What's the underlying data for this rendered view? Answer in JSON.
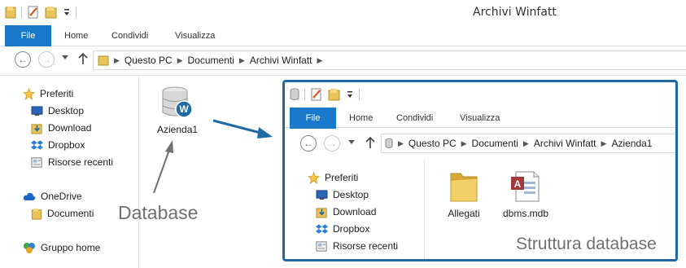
{
  "window": {
    "title": "Archivi Winfatt",
    "ribbon_tabs": {
      "file": "File",
      "home": "Home",
      "share": "Condividi",
      "view": "Visualizza"
    },
    "address": [
      "Questo PC",
      "Documenti",
      "Archivi Winfatt"
    ]
  },
  "nav": {
    "favorites": "Preferiti",
    "desktop": "Desktop",
    "download": "Download",
    "dropbox": "Dropbox",
    "recent": "Risorse recenti",
    "onedrive": "OneDrive",
    "documents": "Documenti",
    "homegroup": "Gruppo home"
  },
  "files": [
    {
      "name": "Azienda1",
      "icon": "database-icon"
    }
  ],
  "annotations": {
    "database": "Database",
    "structure": "Struttura database"
  },
  "inner_window": {
    "ribbon_tabs": {
      "file": "File",
      "home": "Home",
      "share": "Condividi",
      "view": "Visualizza"
    },
    "address": [
      "Questo PC",
      "Documenti",
      "Archivi Winfatt",
      "Azienda1"
    ],
    "nav": {
      "favorites": "Preferiti",
      "desktop": "Desktop",
      "download": "Download",
      "dropbox": "Dropbox",
      "recent": "Risorse recenti"
    },
    "files": [
      {
        "name": "Allegati",
        "icon": "folder-icon"
      },
      {
        "name": "dbms.mdb",
        "icon": "access-database-icon"
      }
    ]
  },
  "colors": {
    "accent": "#1979ca",
    "frame": "#1f6aa5",
    "annotation": "#707070"
  }
}
